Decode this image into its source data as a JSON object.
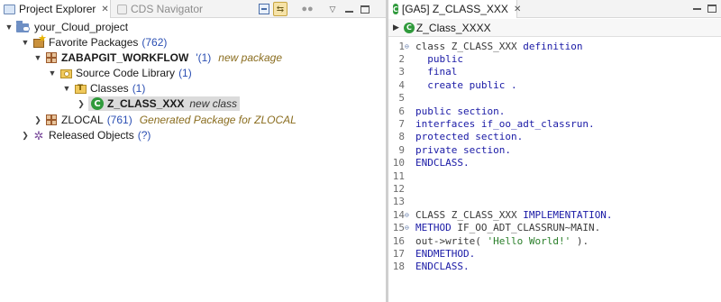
{
  "left_panel": {
    "tabs": [
      {
        "label": "Project Explorer",
        "active": true
      },
      {
        "label": "CDS Navigator",
        "active": false
      }
    ],
    "tree": {
      "project": {
        "label": "your_Cloud_project",
        "expanded": true
      },
      "favorite_packages": {
        "label": "Favorite Packages",
        "count": "(762)",
        "expanded": true
      },
      "zabapgit": {
        "label": "ZABAPGIT_WORKFLOW",
        "count": "'(1)",
        "note": "new package",
        "expanded": true
      },
      "source_library": {
        "label": "Source Code Library",
        "count": "(1)",
        "expanded": true
      },
      "classes": {
        "label": "Classes",
        "count": "(1)",
        "expanded": true
      },
      "z_class": {
        "label": "Z_CLASS_XXX",
        "note": "new class",
        "selected": true
      },
      "zlocal": {
        "label": "ZLOCAL",
        "count": "(761)",
        "note": "Generated Package for ZLOCAL",
        "expanded": false
      },
      "released": {
        "label": "Released Objects",
        "count": "(?)",
        "expanded": false
      }
    }
  },
  "editor": {
    "tab": {
      "label": "[GA5] Z_CLASS_XXX"
    },
    "breadcrumb": "Z_Class_XXXX",
    "lines": [
      {
        "n": "1",
        "fold": "⊖",
        "tokens": [
          {
            "t": "class Z_CLASS_XXX ",
            "c": "ctext"
          },
          {
            "t": "definition",
            "c": "kw"
          }
        ]
      },
      {
        "n": "2",
        "fold": "",
        "tokens": [
          {
            "t": "  public",
            "c": "kw"
          }
        ]
      },
      {
        "n": "3",
        "fold": "",
        "tokens": [
          {
            "t": "  final",
            "c": "kw"
          }
        ]
      },
      {
        "n": "4",
        "fold": "",
        "tokens": [
          {
            "t": "  create public .",
            "c": "kw"
          }
        ]
      },
      {
        "n": "5",
        "fold": "",
        "tokens": []
      },
      {
        "n": "6",
        "fold": "",
        "tokens": [
          {
            "t": "public section.",
            "c": "kw"
          }
        ]
      },
      {
        "n": "7",
        "fold": "",
        "tokens": [
          {
            "t": "interfaces if_oo_adt_classrun.",
            "c": "kw"
          }
        ]
      },
      {
        "n": "8",
        "fold": "",
        "tokens": [
          {
            "t": "protected section.",
            "c": "kw"
          }
        ]
      },
      {
        "n": "9",
        "fold": "",
        "tokens": [
          {
            "t": "private section.",
            "c": "kw"
          }
        ]
      },
      {
        "n": "10",
        "fold": "",
        "tokens": [
          {
            "t": "ENDCLASS.",
            "c": "kw"
          }
        ]
      },
      {
        "n": "11",
        "fold": "",
        "tokens": []
      },
      {
        "n": "12",
        "fold": "",
        "tokens": []
      },
      {
        "n": "13",
        "fold": "",
        "tokens": []
      },
      {
        "n": "14",
        "fold": "⊖",
        "tokens": [
          {
            "t": "CLASS Z_CLASS_XXX ",
            "c": "ctext"
          },
          {
            "t": "IMPLEMENTATION.",
            "c": "kw"
          }
        ]
      },
      {
        "n": "15",
        "fold": "⊖",
        "tokens": [
          {
            "t": "METHOD ",
            "c": "kw"
          },
          {
            "t": "IF_OO_ADT_CLASSRUN~MAIN.",
            "c": "ctext"
          }
        ]
      },
      {
        "n": "16",
        "fold": "",
        "tokens": [
          {
            "t": "out->write( ",
            "c": "ctext"
          },
          {
            "t": "'Hello World!'",
            "c": "str"
          },
          {
            "t": " ).",
            "c": "ctext"
          }
        ]
      },
      {
        "n": "17",
        "fold": "",
        "tokens": [
          {
            "t": "ENDMETHOD.",
            "c": "kw"
          }
        ]
      },
      {
        "n": "18",
        "fold": "",
        "tokens": [
          {
            "t": "ENDCLASS.",
            "c": "kw"
          }
        ]
      }
    ]
  },
  "icons": {
    "close": "close-icon",
    "collapse_all": "collapse-all-icon",
    "link_editor": "link-with-editor-icon",
    "filter": "filter-icon",
    "view_menu": "view-menu-icon",
    "minimize": "minimize-icon",
    "maximize": "maximize-icon"
  },
  "colors": {
    "keyword": "#1a1aa6",
    "string": "#2a7f2a",
    "count": "#2b4fb3",
    "decoration": "#8a6d1f",
    "class_icon": "#2f9a3b"
  }
}
